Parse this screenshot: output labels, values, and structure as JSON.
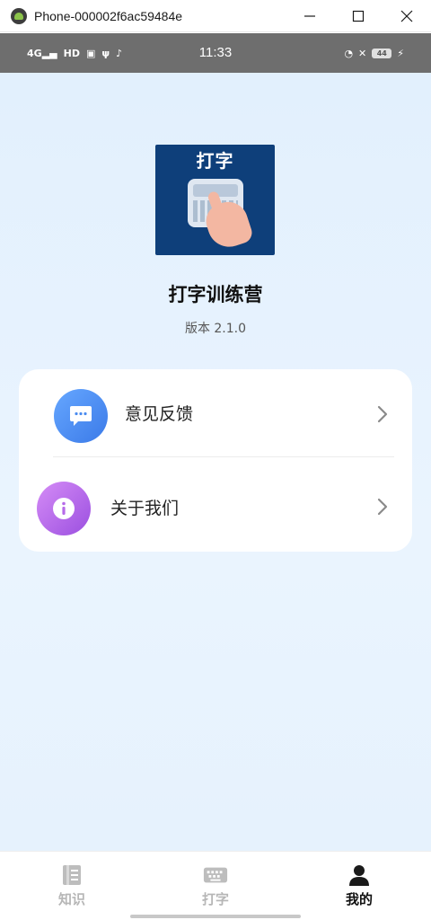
{
  "window": {
    "title": "Phone-000002f6ac59484e",
    "minimize_glyph": "—",
    "maximize_glyph": "☐",
    "close_glyph": "✕"
  },
  "statusbar": {
    "time": "11:33",
    "network": "4G",
    "hd": "HD",
    "battery": "44"
  },
  "app": {
    "logo_text": "打字",
    "name": "打字训练营",
    "version": "版本 2.1.0"
  },
  "menu": {
    "items": [
      {
        "label": "意见反馈",
        "icon": "chat-bubble-icon"
      },
      {
        "label": "关于我们",
        "icon": "info-icon"
      }
    ]
  },
  "nav": {
    "tabs": [
      {
        "label": "知识",
        "icon": "book-icon",
        "active": false
      },
      {
        "label": "打字",
        "icon": "keyboard-icon",
        "active": false
      },
      {
        "label": "我的",
        "icon": "person-icon",
        "active": true
      }
    ]
  },
  "colors": {
    "background": "#e4f1fd",
    "feedback_icon": "#4a8cf0",
    "about_icon": "#b66ae9",
    "nav_active": "#111111",
    "nav_inactive": "#b6b6b6"
  }
}
